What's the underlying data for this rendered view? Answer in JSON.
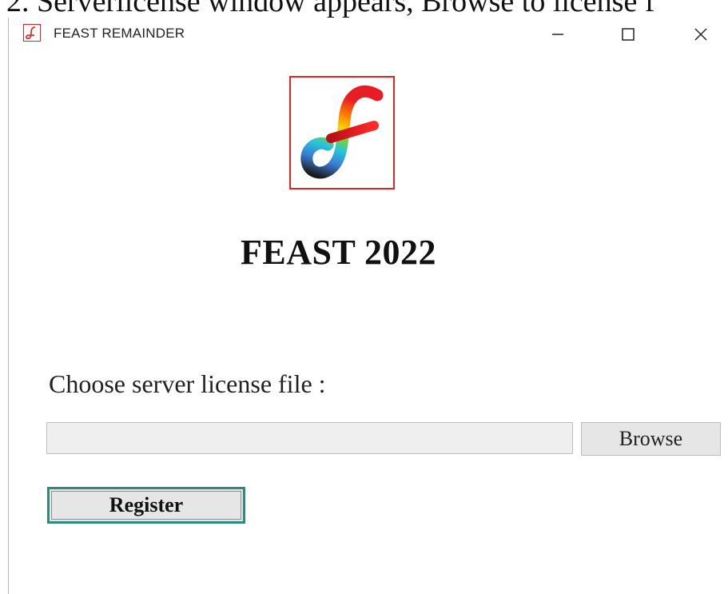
{
  "caption": {
    "text": "2. Serverlicense window appears, Browse to license f"
  },
  "window": {
    "title": "FEAST REMAINDER",
    "icons": {
      "app": "feast-logo-icon",
      "minimize": "minimize-icon",
      "maximize": "maximize-icon",
      "close": "close-icon"
    }
  },
  "main": {
    "logo": "feast-logo",
    "product_title": "FEAST 2022",
    "license_label": "Choose server license file :",
    "license_path": {
      "value": "",
      "placeholder": ""
    },
    "browse_label": "Browse",
    "register_label": "Register"
  },
  "colors": {
    "logo_border": "#d8262a",
    "register_focus_border": "#2d8a80",
    "button_face": "#e6e6e6",
    "input_face": "#efefef"
  }
}
